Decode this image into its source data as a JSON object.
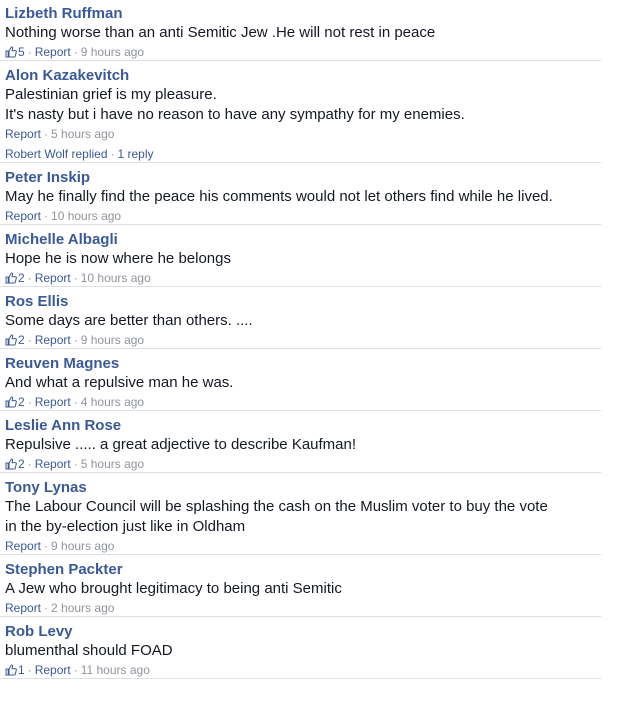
{
  "comments": [
    {
      "author": "Lizbeth Ruffman",
      "lines": [
        "Nothing worse than an anti Semitic Jew .He will not rest in peace"
      ],
      "likes": "5",
      "report": "Report",
      "time": "9 hours ago"
    },
    {
      "author": "Alon Kazakevitch",
      "lines": [
        "Palestinian grief is my pleasure.",
        "It's nasty but i have no reason to have any sympathy for my enemies."
      ],
      "likes": "",
      "report": "Report",
      "time": "5 hours ago",
      "replies_label": "Robert Wolf replied",
      "replies_count": "1 reply"
    },
    {
      "author": "Peter Inskip",
      "lines": [
        "May he finally find the peace his comments would not let others find while he lived."
      ],
      "likes": "",
      "report": "Report",
      "time": "10 hours ago"
    },
    {
      "author": "Michelle Albagli",
      "lines": [
        "Hope he is now where he belongs"
      ],
      "likes": "2",
      "report": "Report",
      "time": "10 hours ago"
    },
    {
      "author": "Ros Ellis",
      "lines": [
        "Some days are better than others. ...."
      ],
      "likes": "2",
      "report": "Report",
      "time": "9 hours ago"
    },
    {
      "author": "Reuven Magnes",
      "lines": [
        "And what a repulsive man he was."
      ],
      "likes": "2",
      "report": "Report",
      "time": "4 hours ago"
    },
    {
      "author": "Leslie Ann Rose",
      "lines": [
        "Repulsive ..... a great adjective to describe Kaufman!"
      ],
      "likes": "2",
      "report": "Report",
      "time": "5 hours ago"
    },
    {
      "author": "Tony Lynas",
      "lines": [
        "The Labour Council will be splashing the cash on the Muslim voter to buy the vote",
        "in the by-election just like in Oldham"
      ],
      "likes": "",
      "report": "Report",
      "time": "9 hours ago"
    },
    {
      "author": "Stephen Packter",
      "lines": [
        "A Jew who brought legitimacy to being anti Semitic"
      ],
      "likes": "",
      "report": "Report",
      "time": "2 hours ago"
    },
    {
      "author": "Rob Levy",
      "lines": [
        "blumenthal should FOAD"
      ],
      "likes": "1",
      "report": "Report",
      "time": "11 hours ago"
    }
  ],
  "colors": {
    "link": "#3b5998",
    "meta": "#90949c",
    "text": "#141823",
    "divider": "#dddfe2"
  }
}
